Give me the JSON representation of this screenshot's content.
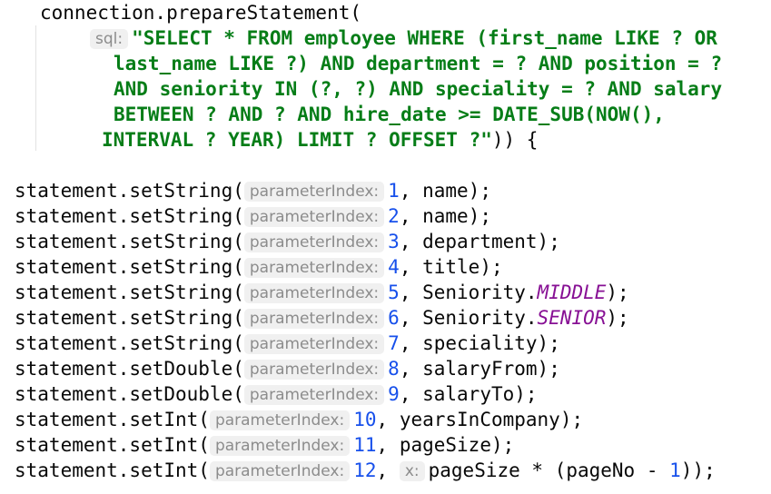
{
  "code": {
    "prepare_call": "connection.prepareStatement(",
    "sql_hint": "sql:",
    "sql_lines": [
      "\"SELECT * FROM employee WHERE (first_name LIKE ? OR",
      "last_name LIKE ?) AND department = ? AND position = ?",
      "AND seniority IN (?, ?) AND speciality = ? AND salary",
      "BETWEEN ? AND ? AND hire_date >= DATE_SUB(NOW(),",
      "INTERVAL ? YEAR) LIMIT ? OFFSET ?\""
    ],
    "prepare_close": ")) {",
    "param_hint": "parameterIndex:",
    "x_hint": "x:",
    "statements": [
      {
        "call": "statement.setString(",
        "index": "1",
        "arg": "name",
        "arg_const": "",
        "close": ");"
      },
      {
        "call": "statement.setString(",
        "index": "2",
        "arg": "name",
        "arg_const": "",
        "close": ");"
      },
      {
        "call": "statement.setString(",
        "index": "3",
        "arg": "department",
        "arg_const": "",
        "close": ");"
      },
      {
        "call": "statement.setString(",
        "index": "4",
        "arg": "title",
        "arg_const": "",
        "close": ");"
      },
      {
        "call": "statement.setString(",
        "index": "5",
        "arg": "Seniority.",
        "arg_const": "MIDDLE",
        "close": ");"
      },
      {
        "call": "statement.setString(",
        "index": "6",
        "arg": "Seniority.",
        "arg_const": "SENIOR",
        "close": ");"
      },
      {
        "call": "statement.setString(",
        "index": "7",
        "arg": "speciality",
        "arg_const": "",
        "close": ");"
      },
      {
        "call": "statement.setDouble(",
        "index": "8",
        "arg": "salaryFrom",
        "arg_const": "",
        "close": ");"
      },
      {
        "call": "statement.setDouble(",
        "index": "9",
        "arg": "salaryTo",
        "arg_const": "",
        "close": ");"
      },
      {
        "call": "statement.setInt(",
        "index": "10",
        "arg": "yearsInCompany",
        "arg_const": "",
        "close": ");"
      },
      {
        "call": "statement.setInt(",
        "index": "11",
        "arg": "pageSize",
        "arg_const": "",
        "close": ");"
      }
    ],
    "last_statement": {
      "call": "statement.setInt(",
      "index": "12",
      "sep": ",",
      "expr_a": "pageSize * (pageNo - ",
      "expr_num": "1",
      "expr_b": "));"
    }
  },
  "colors": {
    "string": "#067d17",
    "number": "#1750eb",
    "constant": "#871094",
    "hint_text": "#8c8c8c",
    "hint_bg": "#f0f0f0",
    "text": "#080808"
  }
}
